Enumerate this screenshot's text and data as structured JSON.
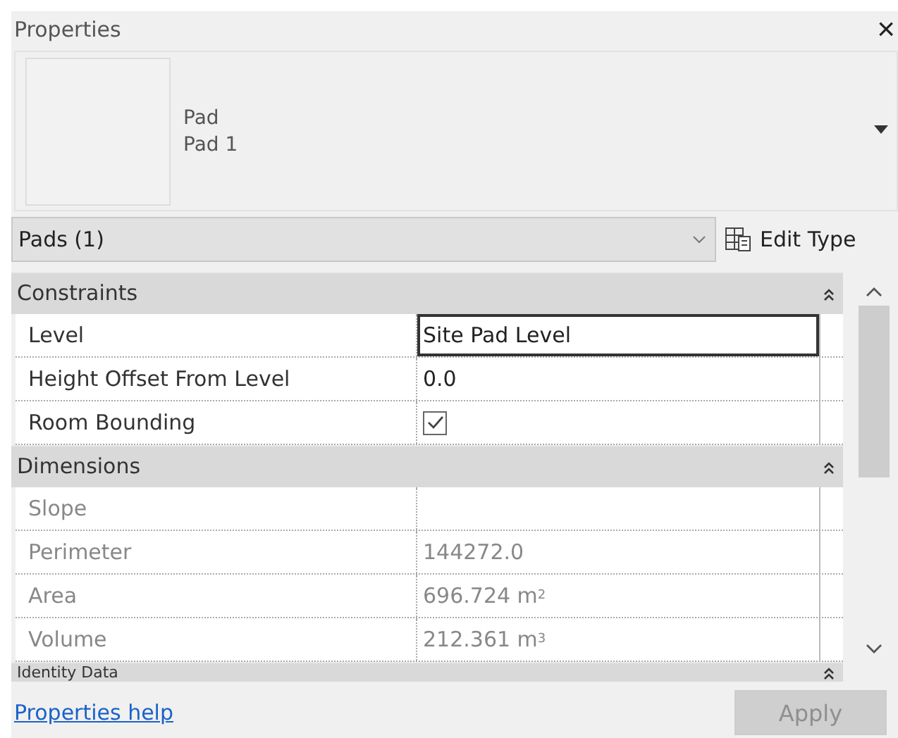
{
  "window": {
    "title": "Properties",
    "close": "×"
  },
  "preview": {
    "lines": [
      "Pad",
      "Pad 1"
    ]
  },
  "type_selector": {
    "value": "Pads (1)",
    "edit_type": "Edit Type"
  },
  "sections": [
    {
      "title": "Constraints",
      "expanded": true,
      "rows": [
        {
          "name": "Level",
          "kind": "text",
          "value": "Site Pad Level",
          "readonly": false,
          "selected": true
        },
        {
          "name": "Height Offset From Level",
          "kind": "text",
          "value": "0.0",
          "readonly": false,
          "selected": false
        },
        {
          "name": "Room Bounding",
          "kind": "checkbox",
          "checked": true,
          "readonly": false,
          "selected": false
        }
      ]
    },
    {
      "title": "Dimensions",
      "expanded": true,
      "rows": [
        {
          "name": "Slope",
          "kind": "text",
          "value": "",
          "readonly": true,
          "selected": false
        },
        {
          "name": "Perimeter",
          "kind": "text",
          "value": "144272.0",
          "readonly": true,
          "selected": false
        },
        {
          "name": "Area",
          "kind": "text",
          "value": "696.724 m$^{2}$",
          "readonly": true,
          "selected": false
        },
        {
          "name": "Volume",
          "kind": "text",
          "value": "212.361 m$^{3}$",
          "readonly": true,
          "selected": false
        }
      ]
    },
    {
      "title": "Identity Data",
      "expanded": true
    }
  ],
  "footer": {
    "help_link": "Properties help",
    "apply": {
      "label": "Apply",
      "disabled": true
    }
  }
}
